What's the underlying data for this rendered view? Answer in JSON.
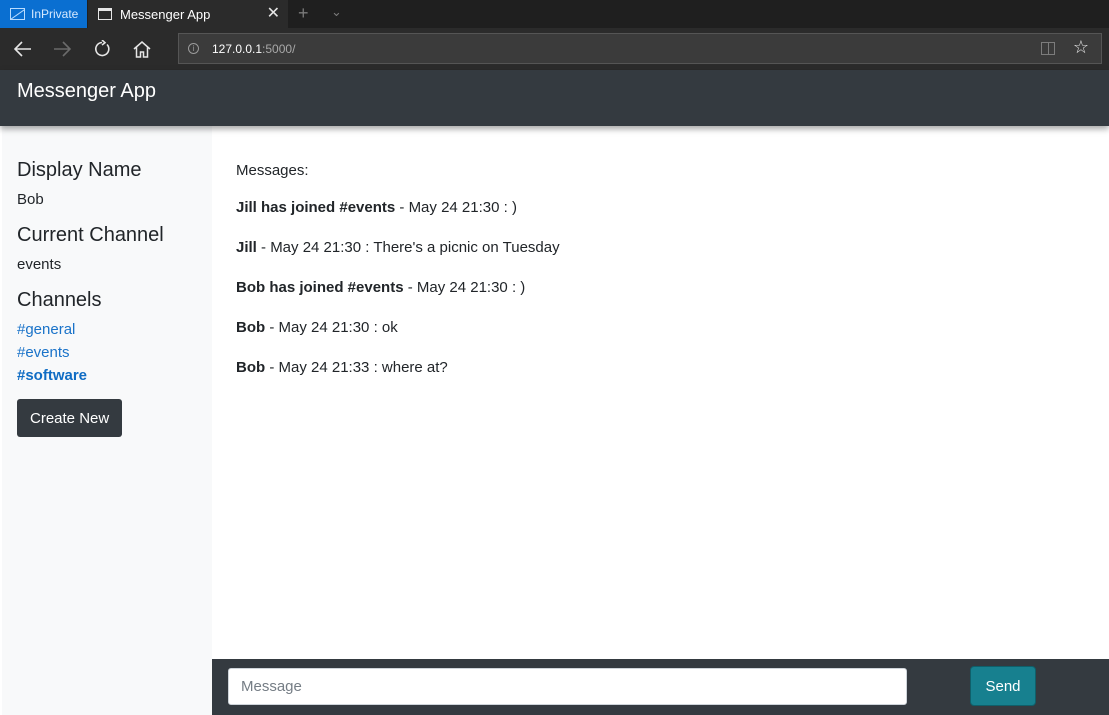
{
  "browser": {
    "inprivate_label": "InPrivate",
    "tab_title": "Messenger App",
    "tab_close_glyph": "✕",
    "new_tab_glyph": "+",
    "tab_menu_glyph": "⌄",
    "url_host": "127.0.0.1",
    "url_rest": ":5000/",
    "icons": {
      "back": "back-arrow-icon",
      "forward": "forward-arrow-icon",
      "refresh": "refresh-icon",
      "home": "home-icon",
      "info": "info-icon",
      "reading_view": "reading-view-icon",
      "favorite": "star-icon"
    },
    "colors": {
      "inprivate": "#0a6fd1",
      "chrome": "#2b2b2b"
    }
  },
  "app": {
    "brand": "Messenger App",
    "colors": {
      "header": "#343a40",
      "sidebar": "#f8f9fa",
      "link": "#1a73c9",
      "send": "#17808f"
    }
  },
  "sidebar": {
    "display_name_heading": "Display Name",
    "display_name_value": "Bob",
    "current_channel_heading": "Current Channel",
    "current_channel_value": "events",
    "channels_heading": "Channels",
    "channels": [
      {
        "label": "#general",
        "active": false
      },
      {
        "label": "#events",
        "active": false
      },
      {
        "label": "#software",
        "active": true
      }
    ],
    "create_new_label": "Create New"
  },
  "messages": {
    "heading": "Messages:",
    "items": [
      {
        "author": "Jill has joined #events",
        "text": " - May 24 21:30 : )"
      },
      {
        "author": "Jill",
        "text": " - May 24 21:30 : There's a picnic on Tuesday"
      },
      {
        "author": "Bob has joined #events",
        "text": " - May 24 21:30 : )"
      },
      {
        "author": "Bob",
        "text": " - May 24 21:30 : ok"
      },
      {
        "author": "Bob",
        "text": " - May 24 21:33 : where at?"
      }
    ]
  },
  "composer": {
    "placeholder": "Message",
    "value": "",
    "send_label": "Send"
  }
}
